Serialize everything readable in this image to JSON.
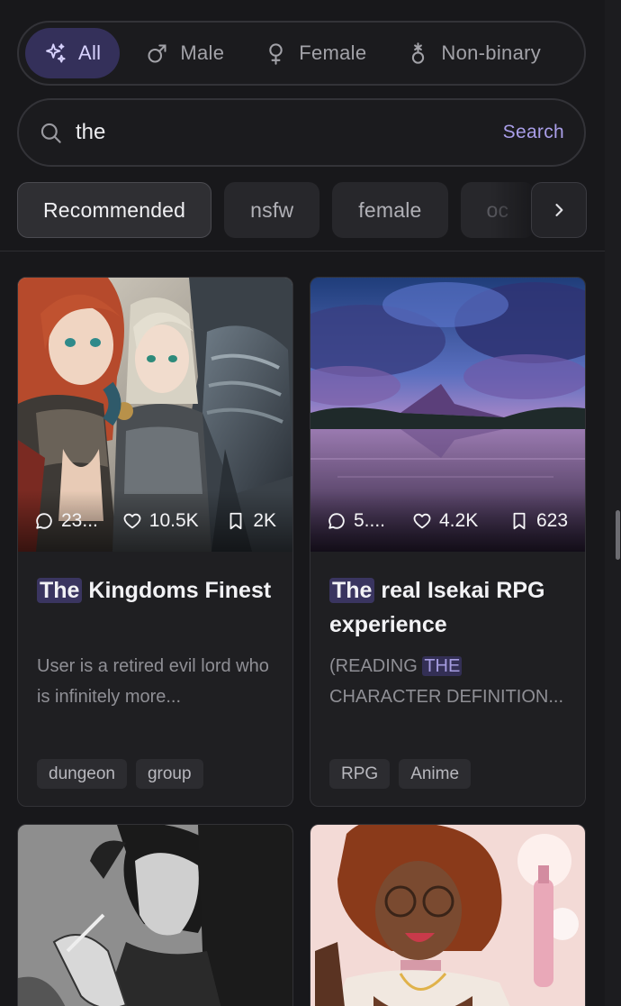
{
  "gender_filter": {
    "options": [
      {
        "label": "All",
        "icon": "sparkles-icon",
        "active": true
      },
      {
        "label": "Male",
        "icon": "male-symbol-icon"
      },
      {
        "label": "Female",
        "icon": "female-symbol-icon"
      },
      {
        "label": "Non-binary",
        "icon": "nonbinary-symbol-icon"
      }
    ]
  },
  "search": {
    "value": "the",
    "button_label": "Search"
  },
  "tags": [
    "Recommended",
    "nsfw",
    "female",
    "oc"
  ],
  "cards": [
    {
      "comments": "23...",
      "likes": "10.5K",
      "bookmarks": "2K",
      "title_highlight": "The",
      "title_rest": " Kingdoms Finest",
      "desc_before": "User is a retired evil lord who is infinitely more...",
      "desc_highlight": "",
      "desc_after": "",
      "tags": [
        "dungeon",
        "group"
      ]
    },
    {
      "comments": "5....",
      "likes": "4.2K",
      "bookmarks": "623",
      "title_highlight": "The",
      "title_rest": " real Isekai RPG experience",
      "desc_before": "(READING ",
      "desc_highlight": "THE",
      "desc_after": " CHARACTER DEFINITION...",
      "tags": [
        "RPG",
        "Anime"
      ]
    }
  ],
  "colors": {
    "background": "#18181b",
    "accent": "#a99ee8",
    "active_pill": "#34305a",
    "highlight": "#3a3560"
  }
}
